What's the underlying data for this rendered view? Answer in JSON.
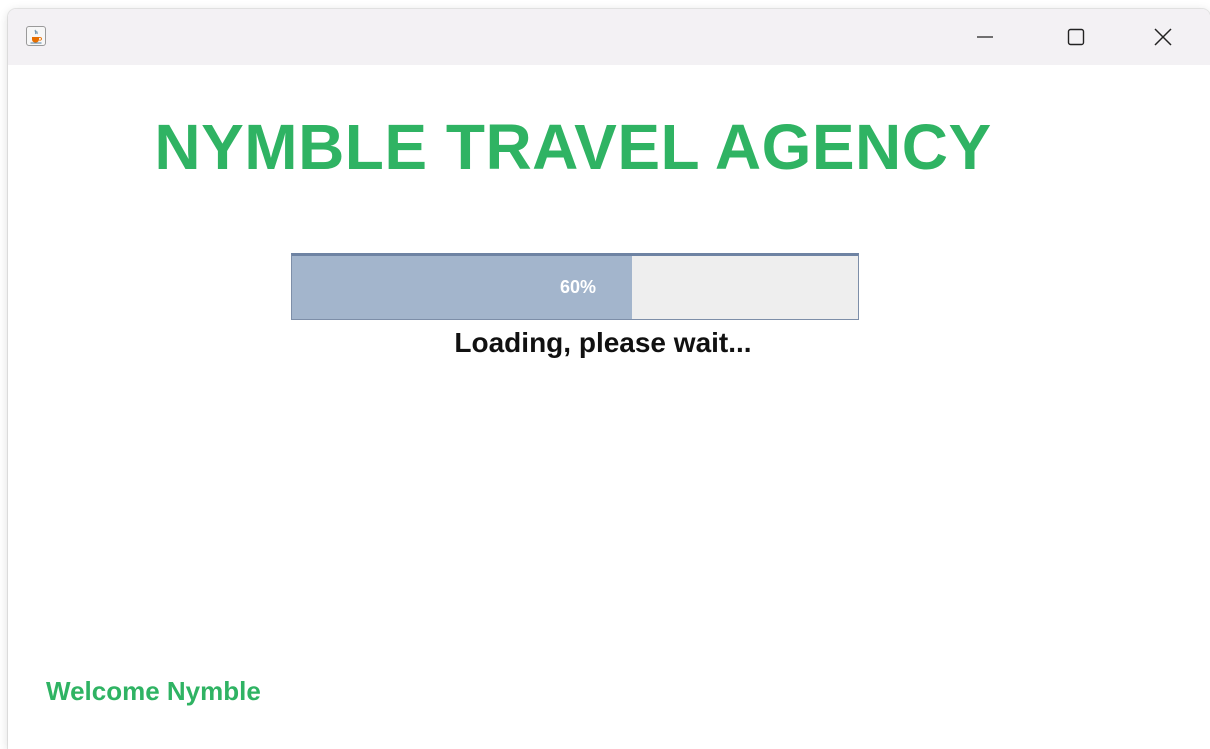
{
  "window": {
    "title": ""
  },
  "main": {
    "title": "NYMBLE TRAVEL AGENCY",
    "progress": {
      "value": 0.6,
      "label": "60%"
    },
    "status_text": "Loading, please wait...",
    "welcome_text": "Welcome Nymble"
  },
  "colors": {
    "accent_green": "#2fb363",
    "progress_fill": "#a3b5cc",
    "progress_track": "#eeeeee",
    "titlebar": "#f3f1f4"
  },
  "icons": {
    "app": "java-cup-icon",
    "minimize": "minimize-icon",
    "maximize": "maximize-icon",
    "close": "close-icon"
  }
}
